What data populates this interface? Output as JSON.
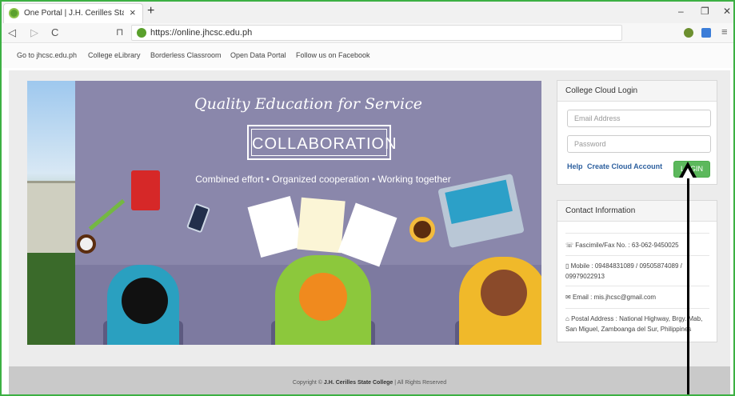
{
  "browser": {
    "tab_title": "One Portal | J.H. Cerilles State Coll",
    "tab_close": "×",
    "new_tab": "+",
    "url": "https://online.jhcsc.edu.ph",
    "back": "◁",
    "forward": "▷",
    "reload": "C",
    "bookmark": "⊓",
    "minimize": "–",
    "restore": "❐",
    "close": "✕",
    "menu": "≡"
  },
  "nav": {
    "items": [
      {
        "label": "Go to jhcsc.edu.ph"
      },
      {
        "label": "College eLibrary"
      },
      {
        "label": "Borderless Classroom"
      },
      {
        "label": "Open Data Portal"
      },
      {
        "label": "Follow us on Facebook"
      }
    ]
  },
  "banner": {
    "headline": "Quality Education for Service",
    "box_label": "COLLABORATION",
    "tagline": "Combined effort  •  Organized cooperation  •  Working together"
  },
  "login": {
    "title": "College Cloud Login",
    "email_placeholder": "Email Address",
    "password_placeholder": "Password",
    "help_label": "Help",
    "create_label": "Create Cloud Account",
    "login_label": "LOGIN"
  },
  "contact": {
    "title": "Contact Information",
    "fax": "Fascimile/Fax No. : 63-062-9450025",
    "mobile_line1": "Mobile : 09484831089 / 09505874089 /",
    "mobile_line2": "09979022913",
    "email": "Email : mis.jhcsc@gmail.com",
    "address_line1": "Postal Address : National Highway, Brgy. Mab,",
    "address_line2": "San Miguel, Zamboanga del Sur, Philippines"
  },
  "footer": {
    "prefix": "Copyright © ",
    "college": "J.H. Cerilles State College",
    "suffix": " | All Rights Reserved"
  }
}
